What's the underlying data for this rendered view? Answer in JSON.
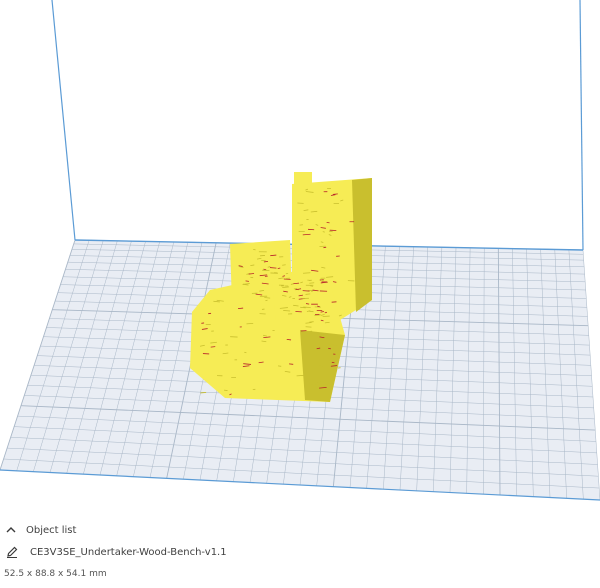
{
  "viewport": {
    "build_plate_color": "#e9edf4",
    "grid_line_color": "#a9b7c7",
    "axis_line_color": "#5b9bd5",
    "model_color": "#f6ec55",
    "model_shadow_color": "#c9bf2e",
    "model_detail_color": "#b8232a"
  },
  "object_panel": {
    "toggle_icon": "chevron-up-icon",
    "title": "Object list",
    "edit_icon": "pencil-icon",
    "object_name": "CE3V3SE_Undertaker-Wood-Bench-v1.1",
    "dimensions": "52.5 x 88.8 x 54.1 mm"
  }
}
